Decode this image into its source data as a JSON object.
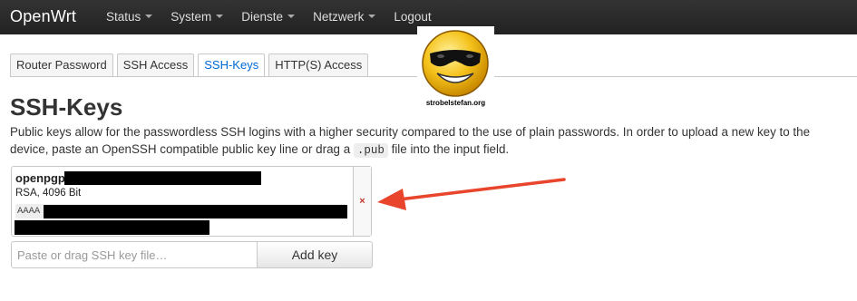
{
  "navbar": {
    "brand": "OpenWrt",
    "menu": [
      {
        "label": "Status",
        "has_dropdown": true
      },
      {
        "label": "System",
        "has_dropdown": true
      },
      {
        "label": "Dienste",
        "has_dropdown": true
      },
      {
        "label": "Netzwerk",
        "has_dropdown": true
      },
      {
        "label": "Logout",
        "has_dropdown": false
      }
    ]
  },
  "tabs": [
    {
      "label": "Router Password",
      "active": false
    },
    {
      "label": "SSH Access",
      "active": false
    },
    {
      "label": "SSH-Keys",
      "active": true
    },
    {
      "label": "HTTP(S) Access",
      "active": false
    }
  ],
  "sticker": {
    "caption": "strobelstefan.org",
    "icon": "sunglasses-smiley"
  },
  "page": {
    "title": "SSH-Keys",
    "description_1": "Public keys allow for the passwordless SSH logins with a higher security compared to the use of plain passwords. In order to upload a new key to the device, paste an OpenSSH compatible public key line or drag a ",
    "description_code": ".pub",
    "description_2": " file into the input field."
  },
  "keys": [
    {
      "title": "openpgp",
      "meta": "RSA, 4096 Bit",
      "data_prefix": "AAAA",
      "redacted": true,
      "remove_label": "×"
    }
  ],
  "add_key": {
    "placeholder": "Paste or drag SSH key file…",
    "button_label": "Add key"
  },
  "colors": {
    "navbar_bg": "#222222",
    "active_tab": "#0069d6",
    "remove": "#c0392b",
    "annotation_arrow": "#e8452c"
  }
}
